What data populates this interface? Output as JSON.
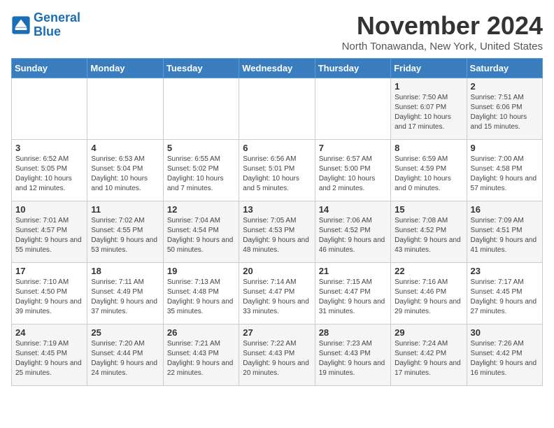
{
  "header": {
    "logo_line1": "General",
    "logo_line2": "Blue",
    "month_title": "November 2024",
    "subtitle": "North Tonawanda, New York, United States"
  },
  "weekdays": [
    "Sunday",
    "Monday",
    "Tuesday",
    "Wednesday",
    "Thursday",
    "Friday",
    "Saturday"
  ],
  "weeks": [
    [
      {
        "day": "",
        "sunrise": "",
        "sunset": "",
        "daylight": ""
      },
      {
        "day": "",
        "sunrise": "",
        "sunset": "",
        "daylight": ""
      },
      {
        "day": "",
        "sunrise": "",
        "sunset": "",
        "daylight": ""
      },
      {
        "day": "",
        "sunrise": "",
        "sunset": "",
        "daylight": ""
      },
      {
        "day": "",
        "sunrise": "",
        "sunset": "",
        "daylight": ""
      },
      {
        "day": "1",
        "sunrise": "Sunrise: 7:50 AM",
        "sunset": "Sunset: 6:07 PM",
        "daylight": "Daylight: 10 hours and 17 minutes."
      },
      {
        "day": "2",
        "sunrise": "Sunrise: 7:51 AM",
        "sunset": "Sunset: 6:06 PM",
        "daylight": "Daylight: 10 hours and 15 minutes."
      }
    ],
    [
      {
        "day": "3",
        "sunrise": "Sunrise: 6:52 AM",
        "sunset": "Sunset: 5:05 PM",
        "daylight": "Daylight: 10 hours and 12 minutes."
      },
      {
        "day": "4",
        "sunrise": "Sunrise: 6:53 AM",
        "sunset": "Sunset: 5:04 PM",
        "daylight": "Daylight: 10 hours and 10 minutes."
      },
      {
        "day": "5",
        "sunrise": "Sunrise: 6:55 AM",
        "sunset": "Sunset: 5:02 PM",
        "daylight": "Daylight: 10 hours and 7 minutes."
      },
      {
        "day": "6",
        "sunrise": "Sunrise: 6:56 AM",
        "sunset": "Sunset: 5:01 PM",
        "daylight": "Daylight: 10 hours and 5 minutes."
      },
      {
        "day": "7",
        "sunrise": "Sunrise: 6:57 AM",
        "sunset": "Sunset: 5:00 PM",
        "daylight": "Daylight: 10 hours and 2 minutes."
      },
      {
        "day": "8",
        "sunrise": "Sunrise: 6:59 AM",
        "sunset": "Sunset: 4:59 PM",
        "daylight": "Daylight: 10 hours and 0 minutes."
      },
      {
        "day": "9",
        "sunrise": "Sunrise: 7:00 AM",
        "sunset": "Sunset: 4:58 PM",
        "daylight": "Daylight: 9 hours and 57 minutes."
      }
    ],
    [
      {
        "day": "10",
        "sunrise": "Sunrise: 7:01 AM",
        "sunset": "Sunset: 4:57 PM",
        "daylight": "Daylight: 9 hours and 55 minutes."
      },
      {
        "day": "11",
        "sunrise": "Sunrise: 7:02 AM",
        "sunset": "Sunset: 4:55 PM",
        "daylight": "Daylight: 9 hours and 53 minutes."
      },
      {
        "day": "12",
        "sunrise": "Sunrise: 7:04 AM",
        "sunset": "Sunset: 4:54 PM",
        "daylight": "Daylight: 9 hours and 50 minutes."
      },
      {
        "day": "13",
        "sunrise": "Sunrise: 7:05 AM",
        "sunset": "Sunset: 4:53 PM",
        "daylight": "Daylight: 9 hours and 48 minutes."
      },
      {
        "day": "14",
        "sunrise": "Sunrise: 7:06 AM",
        "sunset": "Sunset: 4:52 PM",
        "daylight": "Daylight: 9 hours and 46 minutes."
      },
      {
        "day": "15",
        "sunrise": "Sunrise: 7:08 AM",
        "sunset": "Sunset: 4:52 PM",
        "daylight": "Daylight: 9 hours and 43 minutes."
      },
      {
        "day": "16",
        "sunrise": "Sunrise: 7:09 AM",
        "sunset": "Sunset: 4:51 PM",
        "daylight": "Daylight: 9 hours and 41 minutes."
      }
    ],
    [
      {
        "day": "17",
        "sunrise": "Sunrise: 7:10 AM",
        "sunset": "Sunset: 4:50 PM",
        "daylight": "Daylight: 9 hours and 39 minutes."
      },
      {
        "day": "18",
        "sunrise": "Sunrise: 7:11 AM",
        "sunset": "Sunset: 4:49 PM",
        "daylight": "Daylight: 9 hours and 37 minutes."
      },
      {
        "day": "19",
        "sunrise": "Sunrise: 7:13 AM",
        "sunset": "Sunset: 4:48 PM",
        "daylight": "Daylight: 9 hours and 35 minutes."
      },
      {
        "day": "20",
        "sunrise": "Sunrise: 7:14 AM",
        "sunset": "Sunset: 4:47 PM",
        "daylight": "Daylight: 9 hours and 33 minutes."
      },
      {
        "day": "21",
        "sunrise": "Sunrise: 7:15 AM",
        "sunset": "Sunset: 4:47 PM",
        "daylight": "Daylight: 9 hours and 31 minutes."
      },
      {
        "day": "22",
        "sunrise": "Sunrise: 7:16 AM",
        "sunset": "Sunset: 4:46 PM",
        "daylight": "Daylight: 9 hours and 29 minutes."
      },
      {
        "day": "23",
        "sunrise": "Sunrise: 7:17 AM",
        "sunset": "Sunset: 4:45 PM",
        "daylight": "Daylight: 9 hours and 27 minutes."
      }
    ],
    [
      {
        "day": "24",
        "sunrise": "Sunrise: 7:19 AM",
        "sunset": "Sunset: 4:45 PM",
        "daylight": "Daylight: 9 hours and 25 minutes."
      },
      {
        "day": "25",
        "sunrise": "Sunrise: 7:20 AM",
        "sunset": "Sunset: 4:44 PM",
        "daylight": "Daylight: 9 hours and 24 minutes."
      },
      {
        "day": "26",
        "sunrise": "Sunrise: 7:21 AM",
        "sunset": "Sunset: 4:43 PM",
        "daylight": "Daylight: 9 hours and 22 minutes."
      },
      {
        "day": "27",
        "sunrise": "Sunrise: 7:22 AM",
        "sunset": "Sunset: 4:43 PM",
        "daylight": "Daylight: 9 hours and 20 minutes."
      },
      {
        "day": "28",
        "sunrise": "Sunrise: 7:23 AM",
        "sunset": "Sunset: 4:43 PM",
        "daylight": "Daylight: 9 hours and 19 minutes."
      },
      {
        "day": "29",
        "sunrise": "Sunrise: 7:24 AM",
        "sunset": "Sunset: 4:42 PM",
        "daylight": "Daylight: 9 hours and 17 minutes."
      },
      {
        "day": "30",
        "sunrise": "Sunrise: 7:26 AM",
        "sunset": "Sunset: 4:42 PM",
        "daylight": "Daylight: 9 hours and 16 minutes."
      }
    ]
  ]
}
